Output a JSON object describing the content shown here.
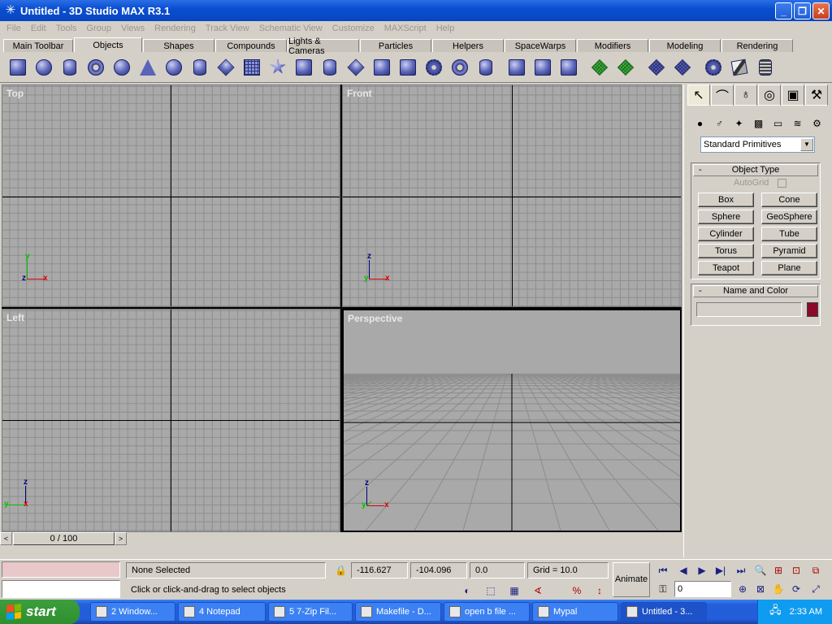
{
  "window": {
    "title": "Untitled - 3D Studio MAX R3.1",
    "app_icon": "max-star-icon",
    "min": "_",
    "max": "❐",
    "close": "✕"
  },
  "menu": [
    "File",
    "Edit",
    "Tools",
    "Group",
    "Views",
    "Rendering",
    "Track View",
    "Schematic View",
    "Customize",
    "MAXScript",
    "Help"
  ],
  "tabs": [
    {
      "label": "Main Toolbar",
      "w": 86
    },
    {
      "label": "Objects",
      "w": 84,
      "active": true
    },
    {
      "label": "Shapes",
      "w": 88
    },
    {
      "label": "Compounds",
      "w": 88
    },
    {
      "label": "Lights & Cameras",
      "w": 88
    },
    {
      "label": "Particles",
      "w": 88
    },
    {
      "label": "Helpers",
      "w": 88
    },
    {
      "label": "SpaceWarps",
      "w": 88
    },
    {
      "label": "Modifiers",
      "w": 88
    },
    {
      "label": "Modeling",
      "w": 88
    },
    {
      "label": "Rendering",
      "w": 88
    }
  ],
  "toolbar_icons": [
    "box",
    "sphere",
    "cylinder",
    "torus",
    "teapot",
    "cone",
    "geosphere",
    "tube",
    "pyramid",
    "plane",
    "hedra",
    "chamfer-box",
    "oil-tank",
    "spindle",
    "gengon",
    "prism",
    "ring-wave",
    "torus-knot",
    "capsule",
    "l-ext",
    "c-ext",
    "hose",
    "patch-grid",
    "tri-patch",
    "nurbs-cv",
    "nurbs-point",
    "nurbs-curve",
    "lathe",
    "spring"
  ],
  "viewports": {
    "top": {
      "label": "Top"
    },
    "front": {
      "label": "Front"
    },
    "left": {
      "label": "Left"
    },
    "perspective": {
      "label": "Perspective"
    }
  },
  "axis": {
    "x": "x",
    "y": "y",
    "z": "z"
  },
  "time_slider": {
    "value": "0 / 100",
    "prev": "<",
    "next": ">"
  },
  "command_panel": {
    "tabs": [
      "create-tab",
      "modify-tab",
      "hierarchy-tab",
      "motion-tab",
      "display-tab",
      "utilities-tab"
    ],
    "categories": [
      "geometry",
      "shapes",
      "lights",
      "cameras",
      "helpers",
      "spacewarps",
      "systems"
    ],
    "category_select": "Standard Primitives",
    "object_type": {
      "header": "Object Type",
      "toggle": "-",
      "autogrid": "AutoGrid",
      "buttons": [
        "Box",
        "Cone",
        "Sphere",
        "GeoSphere",
        "Cylinder",
        "Tube",
        "Torus",
        "Pyramid",
        "Teapot",
        "Plane"
      ]
    },
    "name_color": {
      "header": "Name and Color",
      "toggle": "-",
      "name": "",
      "color": "#8b0a2a"
    }
  },
  "status": {
    "selection": "None Selected",
    "prompt": "Click or click-and-drag to select objects",
    "x": "-116.627",
    "y": "-104.096",
    "z": "0.0",
    "grid": "Grid = 10.0",
    "animate": "Animate",
    "frame": "0",
    "maxscript_color": "#e8c8c8"
  },
  "taskbar": {
    "start": "start",
    "tasks": [
      {
        "label": "2 Window...",
        "w": 105
      },
      {
        "label": "4 Notepad",
        "w": 108
      },
      {
        "label": "5 7-Zip Fil...",
        "w": 104
      },
      {
        "label": "Makefile - D...",
        "w": 106
      },
      {
        "label": "open b file ...",
        "w": 106
      },
      {
        "label": "Mypal",
        "w": 106
      },
      {
        "label": "Untitled - 3...",
        "w": 106,
        "active": true
      }
    ],
    "clock": "2:33 AM"
  }
}
